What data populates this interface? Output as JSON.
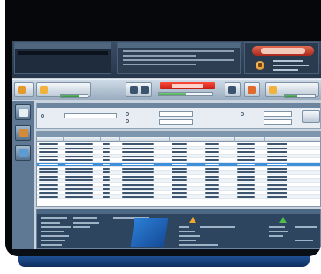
{
  "window": {
    "title": ""
  },
  "top_panel": {
    "user_title": "",
    "user_value": "",
    "center_title": "",
    "center_lines": [
      "",
      "",
      "",
      "",
      "",
      ""
    ],
    "logo_text": "",
    "info_lines": [
      "",
      "",
      ""
    ]
  },
  "toolbar": {
    "left_button_label": "",
    "left_progress_value": 0.65,
    "center_button_label": "",
    "right_button_label": "",
    "red_title": "",
    "right_progress_value": 0.5,
    "far_right_progress_value": 0.4,
    "colors": {
      "accent": "#c01c12",
      "ok": "#2f8f35",
      "warning": "#f2a72a"
    }
  },
  "sidebar": {
    "items": [
      {
        "label": "",
        "icon": "document-icon"
      },
      {
        "label": "",
        "icon": "folder-icon"
      },
      {
        "label": "",
        "icon": "map-icon"
      }
    ]
  },
  "search": {
    "title": "",
    "field_label_1": "",
    "field_label_2": "",
    "field_label_3": "",
    "option_1": "",
    "option_2": "",
    "button_label": ""
  },
  "results": {
    "caption": "",
    "columns": [
      "",
      "",
      "",
      "",
      "",
      "",
      "",
      ""
    ],
    "rows": [
      [
        "",
        "",
        "",
        "",
        "",
        "",
        "",
        ""
      ],
      [
        "",
        "",
        "",
        "",
        "",
        "",
        "",
        ""
      ],
      [
        "",
        "",
        "",
        "",
        "",
        "",
        "",
        ""
      ],
      [
        "",
        "",
        "",
        "",
        "",
        "",
        "",
        ""
      ],
      [
        "",
        "",
        "",
        "",
        "",
        "",
        "",
        ""
      ],
      [
        "",
        "",
        "",
        "",
        "",
        "",
        "",
        ""
      ],
      [
        "",
        "",
        "",
        "",
        "",
        "",
        "",
        ""
      ],
      [
        "",
        "",
        "",
        "",
        "",
        "",
        "",
        ""
      ],
      [
        "",
        "",
        "",
        "",
        "",
        "",
        "",
        ""
      ],
      [
        "",
        "",
        "",
        "",
        "",
        "",
        "",
        ""
      ],
      [
        "",
        "",
        "",
        "",
        "",
        "",
        "",
        ""
      ],
      [
        "",
        "",
        "",
        "",
        "",
        "",
        "",
        ""
      ],
      [
        "",
        "",
        "",
        "",
        "",
        "",
        "",
        ""
      ],
      [
        "",
        "",
        "",
        "",
        "",
        "",
        "",
        ""
      ]
    ],
    "selected_row": 5
  },
  "details": {
    "caption": "",
    "left_labels": [
      "",
      "",
      "",
      "",
      "",
      "",
      ""
    ],
    "center_label": "",
    "right_labels": [
      "",
      "",
      "",
      "",
      ""
    ]
  }
}
